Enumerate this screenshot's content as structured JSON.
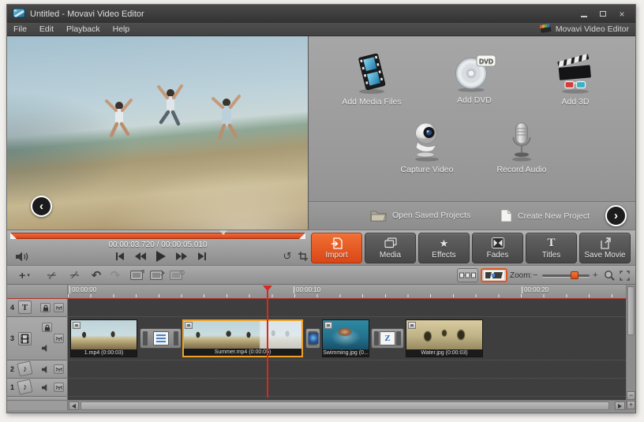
{
  "window": {
    "title": "Untitled - Movavi Video Editor",
    "close_glyph": "×"
  },
  "menu": {
    "items": [
      "File",
      "Edit",
      "Playback",
      "Help"
    ],
    "brand": "Movavi Video Editor"
  },
  "launchpad": {
    "items": [
      {
        "label": "Add Media Files"
      },
      {
        "label": "Add DVD",
        "badge": "DVD"
      },
      {
        "label": "Add 3D"
      },
      {
        "label": "Capture Video"
      },
      {
        "label": "Record Audio"
      }
    ],
    "footer": [
      {
        "label": "Open Saved Projects"
      },
      {
        "label": "Create New Project"
      }
    ]
  },
  "preview": {
    "time_display": "00:00:03.720 / 00:00:05.010"
  },
  "mode_buttons": [
    {
      "label": "Import"
    },
    {
      "label": "Media"
    },
    {
      "label": "Effects"
    },
    {
      "label": "Fades"
    },
    {
      "label": "Titles"
    },
    {
      "label": "Save Movie"
    }
  ],
  "toolbar": {
    "zoom_label": "Zoom:",
    "zoom_out": "−",
    "zoom_in": "+"
  },
  "timeline": {
    "ruler": [
      "00:00:00",
      "00:00:10",
      "00:00:20"
    ],
    "tracks": [
      {
        "number": "4",
        "type": "title"
      },
      {
        "number": "3",
        "type": "video"
      },
      {
        "number": "2",
        "type": "audio"
      },
      {
        "number": "1",
        "type": "audio"
      }
    ],
    "clips": [
      {
        "name": "1.mp4 (0:00:03)"
      },
      {
        "name": "Summer.mp4 (0:00:05)",
        "selected": true
      },
      {
        "name": "Swimming.jpg (0..."
      },
      {
        "name": "Water.jpg (0:00:03)"
      }
    ],
    "transition_z": "Z"
  },
  "glyphs": {
    "plus": "+",
    "caret": "▾",
    "scissors": "✂",
    "undo": "↶",
    "redo": "↷",
    "rotate": "↺",
    "star": "★",
    "titles_t": "T",
    "track_title": "T",
    "note": "♪",
    "chevron_left": "‹",
    "chevron_right": "›"
  },
  "colors": {
    "accent_orange": "#e8562a",
    "selection_orange": "#efa227",
    "playhead_red": "#d9281e",
    "transition_blue": "#2f6fb5"
  }
}
